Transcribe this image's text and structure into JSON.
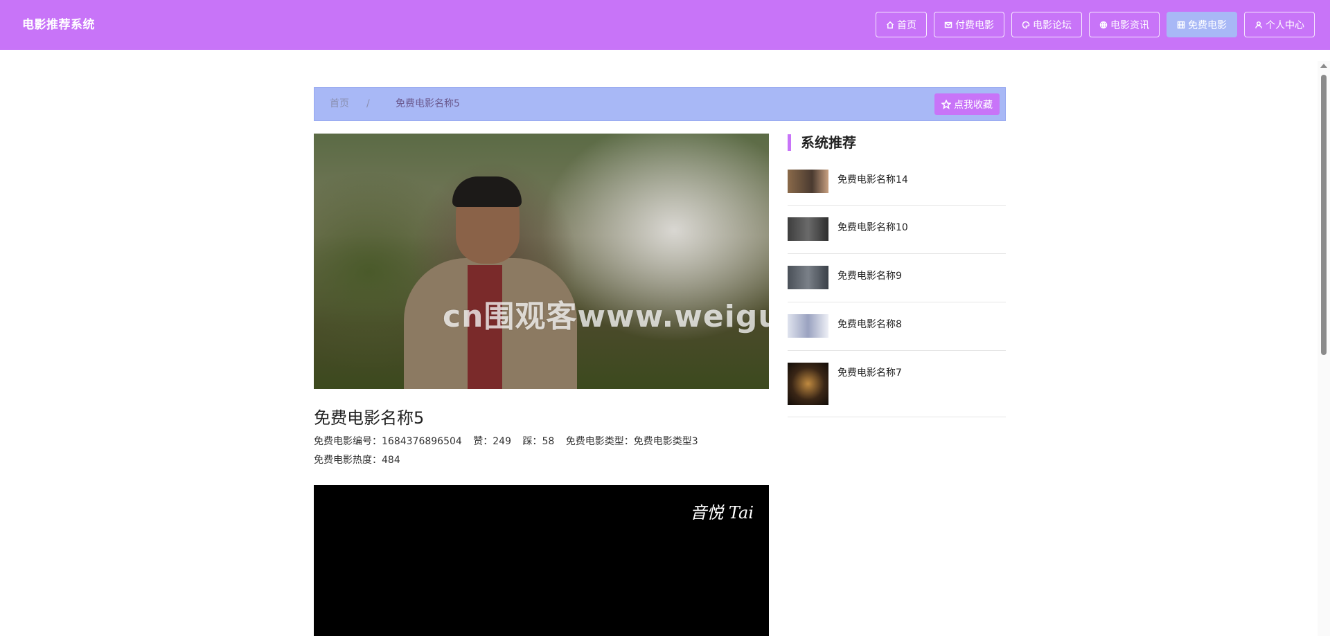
{
  "header": {
    "title": "电影推荐系统",
    "nav": [
      {
        "label": "首页",
        "icon": "home-icon"
      },
      {
        "label": "付费电影",
        "icon": "mail-icon"
      },
      {
        "label": "电影论坛",
        "icon": "palette-icon"
      },
      {
        "label": "电影资讯",
        "icon": "globe-icon"
      },
      {
        "label": "免费电影",
        "icon": "film-icon",
        "active": true
      },
      {
        "label": "个人中心",
        "icon": "user-icon"
      }
    ]
  },
  "breadcrumb": {
    "home": "首页",
    "separator": "/",
    "current": "免费电影名称5",
    "favorite_label": "点我收藏"
  },
  "poster": {
    "watermark": "cn围观客www.weiguanke.cn"
  },
  "detail": {
    "title": "免费电影名称5",
    "number_label": "免费电影编号：",
    "number_value": "1684376896504",
    "like_label": "赞：",
    "like_value": "249",
    "dislike_label": "踩：",
    "dislike_value": "58",
    "type_label": "免费电影类型：",
    "type_value": "免费电影类型3",
    "heat_label": "免费电影热度：",
    "heat_value": "484"
  },
  "video": {
    "logo_text": "音悦 Tai"
  },
  "sidebar": {
    "title": "系统推荐",
    "items": [
      {
        "name": "免费电影名称14",
        "thumb_color": "#6a5848"
      },
      {
        "name": "免费电影名称10",
        "thumb_color": "#4e4e4e"
      },
      {
        "name": "免费电影名称9",
        "thumb_color": "#5c6268"
      },
      {
        "name": "免费电影名称8",
        "thumb_color": "#c8ccd8"
      },
      {
        "name": "免费电影名称7",
        "thumb_color": "#2a1e14"
      }
    ]
  },
  "colors": {
    "header_bg": "#c874f8",
    "breadcrumb_bg": "#a8b8f6",
    "accent": "#c874f8"
  }
}
